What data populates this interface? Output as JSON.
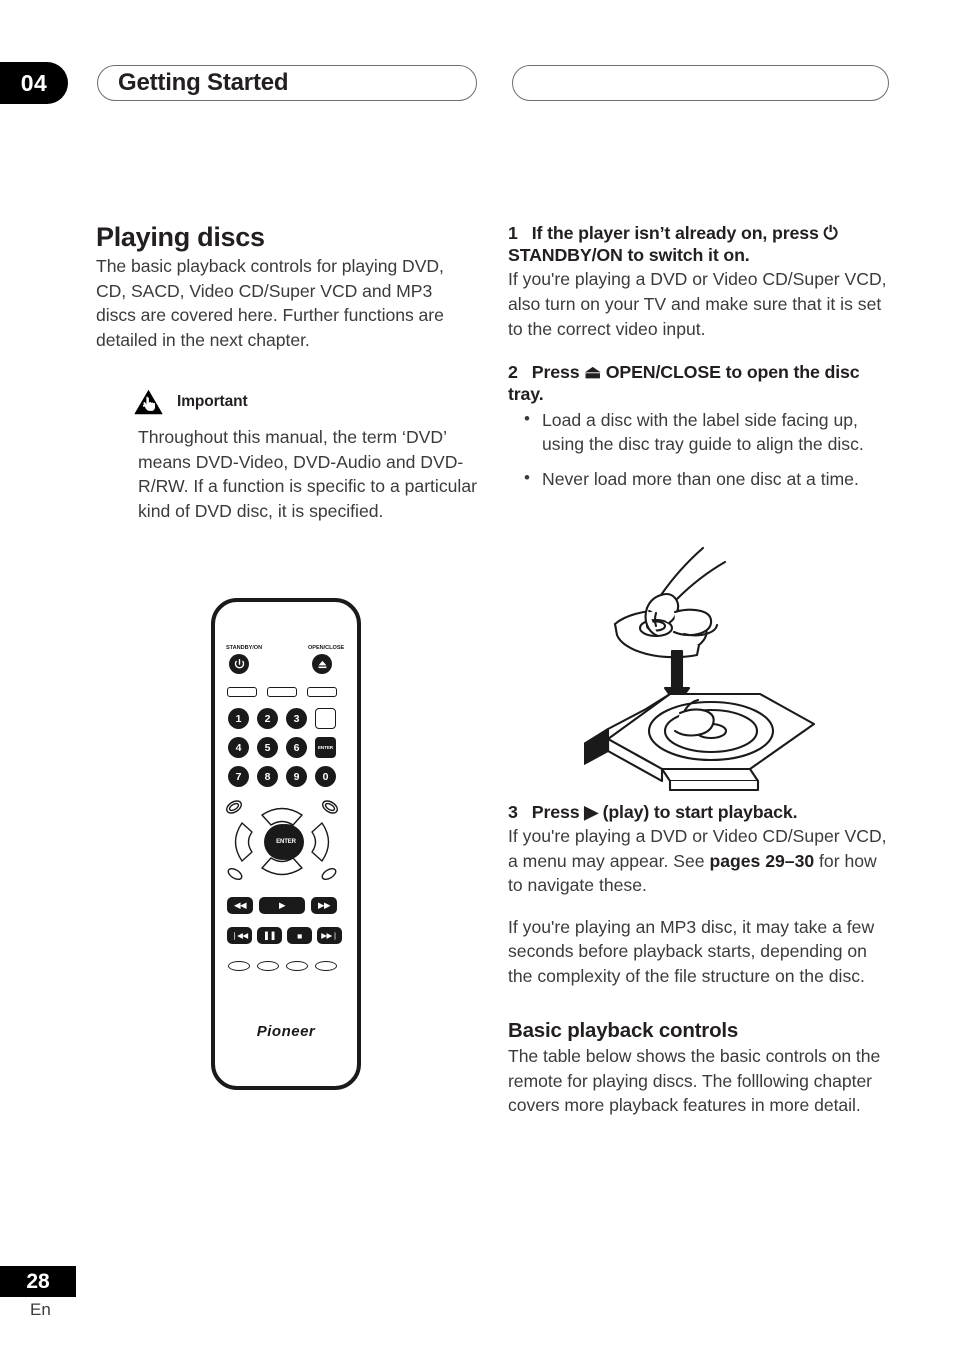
{
  "header": {
    "chapter_number": "04",
    "chapter_title": "Getting Started"
  },
  "left_column": {
    "section_title": "Playing discs",
    "intro": "The basic playback controls for playing DVD, CD, SACD, Video CD/Super VCD and MP3 discs are covered here. Further functions are detailed in the next chapter.",
    "important": {
      "icon": "warning-hand-icon",
      "label": "Important",
      "text": "Throughout this manual, the term ‘DVD’ means DVD-Video, DVD-Audio and DVD-R/RW. If a function is specific to a particular kind of DVD disc, it is specified."
    }
  },
  "right_column": {
    "steps": [
      {
        "number": "1",
        "heading_before": "If the player isn’t already on, press ",
        "heading_symbol": "⏻",
        "heading_symbol_name": "power-standby-icon",
        "heading_after": " STANDBY/ON to switch it on.",
        "body": "If you're playing a DVD or Video CD/Super VCD, also turn on your TV and make sure that it is set to the correct video input."
      },
      {
        "number": "2",
        "heading_before": "Press ",
        "heading_symbol": "⏏",
        "heading_symbol_name": "eject-icon",
        "heading_after": " OPEN/CLOSE to open the disc tray.",
        "bullets": [
          "Load a disc with the label side facing up, using the disc tray guide to align the disc.",
          "Never load more than one disc at a time."
        ]
      },
      {
        "number": "3",
        "heading_before": "Press ",
        "heading_symbol": "▶",
        "heading_symbol_name": "play-icon",
        "heading_after": " (play) to start playback.",
        "body_part1": "If you're playing a DVD or Video CD/Super VCD, a menu may appear. See ",
        "body_bold": "pages 29–30",
        "body_part2": " for how to navigate these.",
        "body2": "If you're playing an MP3 disc, it may take a few seconds before playback starts, depending on the complexity of the file structure on the disc."
      }
    ],
    "sub_section": {
      "title": "Basic playback controls",
      "text": "The table below shows the basic controls on the remote for playing discs. The folllowing chapter covers more playback features in more detail."
    }
  },
  "remote": {
    "standby_label": "STANDBY/ON",
    "open_close_label": "OPEN/CLOSE",
    "standby_icon": "power-standby-icon",
    "open_close_icon": "eject-icon",
    "number_keys": [
      "1",
      "2",
      "3",
      "4",
      "5",
      "6",
      "7",
      "8",
      "9",
      "0"
    ],
    "enter_small_label": "ENTER",
    "enter_center_label": "ENTER",
    "transport_row1": [
      "◀◀",
      "▶",
      "▶▶"
    ],
    "transport_row2": [
      "❘◀◀",
      "❚❚",
      "■",
      "▶▶❘"
    ],
    "brand": "Pioneer"
  },
  "illustration": {
    "name": "hand-loading-disc-into-tray"
  },
  "footer": {
    "page_number": "28",
    "language": "En"
  }
}
